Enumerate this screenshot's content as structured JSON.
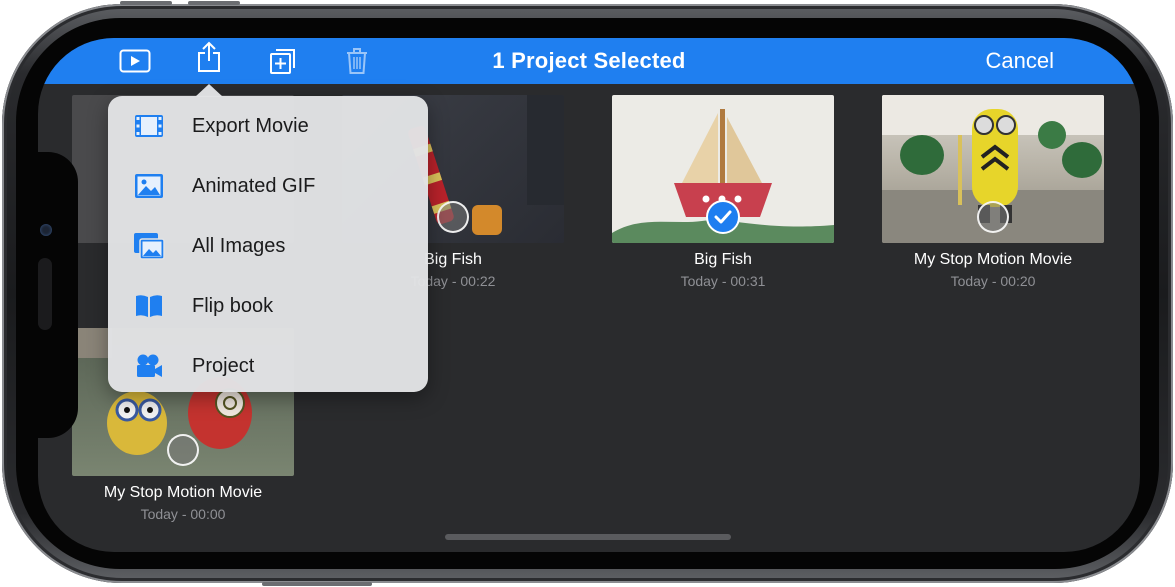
{
  "navbar": {
    "title": "1 Project Selected",
    "cancel_label": "Cancel",
    "icons": [
      "play-icon",
      "share-icon",
      "duplicate-icon",
      "trash-icon"
    ],
    "accent": "#1f7ff0"
  },
  "share_menu": {
    "items": [
      {
        "label": "Export Movie",
        "icon": "film-icon"
      },
      {
        "label": "Animated GIF",
        "icon": "image-icon"
      },
      {
        "label": "All Images",
        "icon": "images-icon"
      },
      {
        "label": "Flip book",
        "icon": "book-icon"
      },
      {
        "label": "Project",
        "icon": "camera-icon"
      }
    ]
  },
  "projects": [
    {
      "title": "Big Fish",
      "subtitle": "Today - 00:22",
      "selected": false
    },
    {
      "title": "Big Fish",
      "subtitle": "Today - 00:31",
      "selected": true
    },
    {
      "title": "My Stop Motion Movie",
      "subtitle": "Today - 00:20",
      "selected": false
    },
    {
      "title": "My Stop Motion Movie",
      "subtitle": "Today - 00:00",
      "selected": false
    }
  ]
}
